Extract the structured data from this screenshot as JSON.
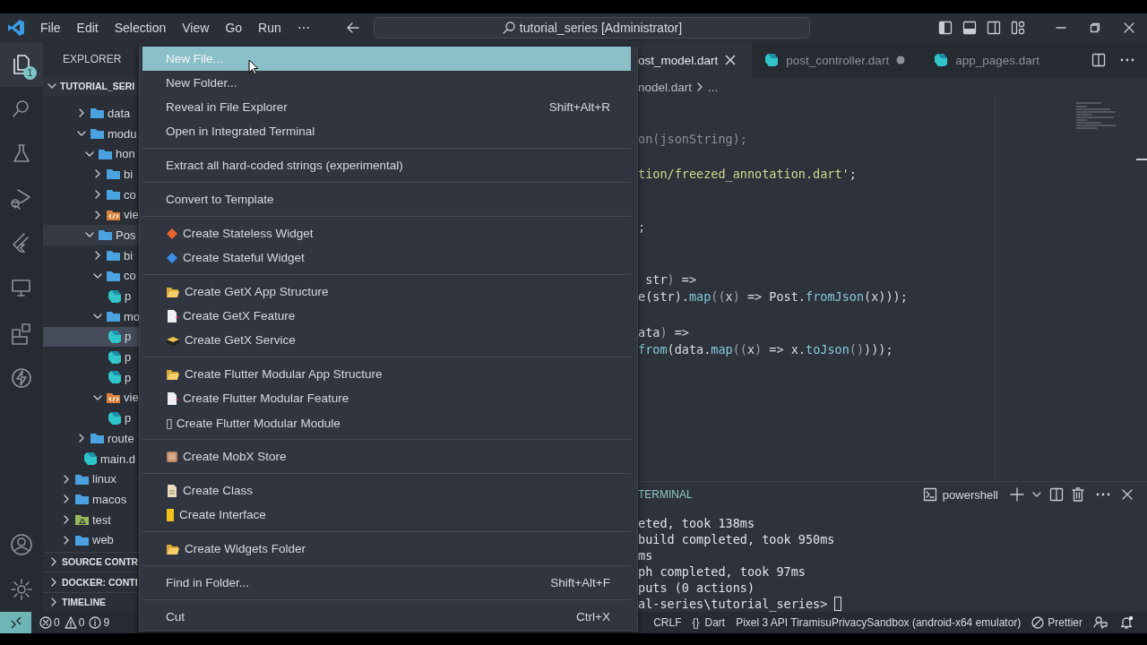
{
  "title_bar": {
    "menus": [
      "File",
      "Edit",
      "Selection",
      "View",
      "Go",
      "Run",
      "⋯"
    ],
    "command_center": "tutorial_series [Administrator]"
  },
  "activity_bar": {
    "items": [
      {
        "kind": "files",
        "badge": "1",
        "selected": true
      },
      {
        "kind": "search",
        "selected": false
      },
      {
        "kind": "flask",
        "selected": false
      },
      {
        "kind": "debug",
        "selected": false
      },
      {
        "kind": "flutter",
        "selected": false
      },
      {
        "kind": "remote",
        "selected": false
      },
      {
        "kind": "extensions",
        "selected": false
      },
      {
        "kind": "lightning",
        "selected": false
      }
    ],
    "bottom": [
      {
        "kind": "account"
      },
      {
        "kind": "settings"
      }
    ]
  },
  "sidebar": {
    "title": "EXPLORER",
    "root": {
      "label": "TUTORIAL_SERI",
      "expanded": true
    },
    "tree": [
      {
        "children": [
          {
            "label": "data",
            "kind": "folder",
            "expanded": false,
            "selected": false,
            "hover": false
          },
          {
            "label": "modu",
            "kind": "folder",
            "expanded": true,
            "selected": false,
            "hover": false,
            "children": [
              {
                "label": "hon",
                "kind": "folder",
                "expanded": true,
                "selected": false,
                "hover": false,
                "children": [
                  {
                    "label": "bi",
                    "kind": "folder",
                    "expanded": false,
                    "selected": false,
                    "hover": false
                  },
                  {
                    "label": "co",
                    "kind": "folder",
                    "expanded": false,
                    "selected": false,
                    "hover": false
                  },
                  {
                    "label": "vie",
                    "kind": "view",
                    "expanded": false,
                    "selected": false,
                    "hover": false
                  }
                ]
              },
              {
                "label": "Pos",
                "kind": "folder",
                "expanded": true,
                "selected": false,
                "hover": true,
                "children": [
                  {
                    "label": "bi",
                    "kind": "folder",
                    "expanded": false,
                    "selected": false,
                    "hover": false
                  },
                  {
                    "label": "co",
                    "kind": "folder",
                    "expanded": true,
                    "selected": false,
                    "hover": false,
                    "children": [
                      {
                        "label": "p",
                        "kind": "dart",
                        "selected": false,
                        "hover": false
                      }
                    ]
                  },
                  {
                    "label": "mo",
                    "kind": "folder",
                    "expanded": true,
                    "selected": false,
                    "hover": false,
                    "children": [
                      {
                        "label": "p",
                        "kind": "dart",
                        "selected": true,
                        "hover": false
                      },
                      {
                        "label": "p",
                        "kind": "dart",
                        "selected": false,
                        "hover": false
                      },
                      {
                        "label": "p",
                        "kind": "dart",
                        "selected": false,
                        "hover": false
                      }
                    ]
                  },
                  {
                    "label": "vie",
                    "kind": "view",
                    "expanded": true,
                    "selected": false,
                    "hover": false,
                    "children": [
                      {
                        "label": "p",
                        "kind": "dart",
                        "selected": false,
                        "hover": false
                      }
                    ]
                  }
                ]
              }
            ]
          },
          {
            "label": "route",
            "kind": "folder",
            "expanded": false,
            "selected": false,
            "hover": false
          },
          {
            "label": "main.d",
            "kind": "dart",
            "selected": false,
            "hover": false
          }
        ]
      },
      {
        "label": "linux",
        "kind": "folder",
        "expanded": false,
        "selected": false,
        "hover": false
      },
      {
        "label": "macos",
        "kind": "folder",
        "expanded": false,
        "selected": false,
        "hover": false
      },
      {
        "label": "test",
        "kind": "test",
        "expanded": false,
        "selected": false,
        "hover": false
      },
      {
        "label": "web",
        "kind": "folder",
        "expanded": false,
        "selected": false,
        "hover": false
      }
    ],
    "sections": [
      {
        "label": "SOURCE CONTR",
        "expanded": false
      },
      {
        "label": "DOCKER: CONTI",
        "expanded": false
      },
      {
        "label": "TIMELINE",
        "expanded": false
      }
    ]
  },
  "context_menu": {
    "groups": [
      [
        {
          "label": "New File...",
          "selected": true
        },
        {
          "label": "New Folder...",
          "selected": false
        },
        {
          "label": "Reveal in File Explorer",
          "shortcut": "Shift+Alt+R",
          "selected": false
        },
        {
          "label": "Open in Integrated Terminal",
          "selected": false
        }
      ],
      [
        {
          "label": "Extract all hard-coded strings (experimental)",
          "selected": false
        }
      ],
      [
        {
          "label": "Convert to Template",
          "selected": false
        }
      ],
      [
        {
          "label": "Create Stateless Widget",
          "kind": "diamond",
          "color": "#e8662e",
          "selected": false
        },
        {
          "label": "Create Stateful Widget",
          "kind": "diamond",
          "color": "#3a8ee6",
          "selected": false
        }
      ],
      [
        {
          "label": "Create GetX App Structure",
          "kind": "folder",
          "selected": false
        },
        {
          "label": "Create GetX Feature",
          "kind": "file",
          "selected": false
        },
        {
          "label": "Create GetX Service",
          "kind": "box",
          "selected": false
        }
      ],
      [
        {
          "label": "Create Flutter Modular App Structure",
          "kind": "folder",
          "selected": false
        },
        {
          "label": "Create Flutter Modular Feature",
          "kind": "file",
          "selected": false
        },
        {
          "label": "▯ Create Flutter Modular Module",
          "selected": false
        }
      ],
      [
        {
          "label": "Create MobX Store",
          "kind": "store",
          "selected": false
        }
      ],
      [
        {
          "label": "Create Class",
          "kind": "class",
          "selected": false
        },
        {
          "label": "Create Interface",
          "kind": "interface",
          "selected": false
        }
      ],
      [
        {
          "label": "Create Widgets Folder",
          "kind": "folder",
          "selected": false
        }
      ],
      [
        {
          "label": "Find in Folder...",
          "shortcut": "Shift+Alt+F",
          "selected": false
        }
      ],
      [
        {
          "label": "Cut",
          "shortcut": "Ctrl+X",
          "selected": false
        }
      ]
    ]
  },
  "editor": {
    "tabs": [
      {
        "label": "ost_model.dart",
        "selected": true,
        "modified": false
      },
      {
        "label": "post_controller.dart",
        "kind": "dart",
        "selected": false,
        "modified": true
      },
      {
        "label": "app_pages.dart",
        "kind": "dart",
        "selected": false,
        "modified": false
      }
    ],
    "breadcrumb": [
      "nodel.dart",
      "..."
    ],
    "code": [
      {
        "kind": "tight",
        "tokens": [
          {
            "text": "on(jsonString);",
            "kind": "dim"
          }
        ]
      },
      {
        "kind": "spaced",
        "tokens": [
          {
            "text": "tion/freezed_annotation.dart'",
            "kind": "str"
          },
          {
            "text": ";",
            "kind": "plain"
          }
        ]
      },
      {
        "kind": "wide",
        "tokens": [
          {
            "text": ";",
            "kind": "plain"
          }
        ]
      },
      {
        "kind": "wide",
        "tokens": [
          {
            "text": " str",
            "kind": "plain"
          },
          {
            "text": ")",
            "kind": "punct"
          },
          {
            "text": " =>",
            "kind": "plain"
          }
        ]
      },
      {
        "kind": "tight",
        "tokens": [
          {
            "text": "e(str).",
            "kind": "plain"
          },
          {
            "text": "map",
            "kind": "fn"
          },
          {
            "text": "((",
            "kind": "punct"
          },
          {
            "text": "x",
            "kind": "plain"
          },
          {
            "text": ")",
            "kind": "punct"
          },
          {
            "text": " => Post.",
            "kind": "plain"
          },
          {
            "text": "fromJson",
            "kind": "fn"
          },
          {
            "text": "(x)));",
            "kind": "plain"
          }
        ]
      },
      {
        "kind": "spaced",
        "tokens": [
          {
            "text": "ata",
            "kind": "plain"
          },
          {
            "text": ")",
            "kind": "punct"
          },
          {
            "text": " =>",
            "kind": "plain"
          }
        ]
      },
      {
        "kind": "tight",
        "tokens": [
          {
            "text": "from",
            "kind": "fn"
          },
          {
            "text": "(data.",
            "kind": "plain"
          },
          {
            "text": "map",
            "kind": "fn"
          },
          {
            "text": "((",
            "kind": "punct"
          },
          {
            "text": "x",
            "kind": "plain"
          },
          {
            "text": ")",
            "kind": "punct"
          },
          {
            "text": " => x.",
            "kind": "plain"
          },
          {
            "text": "toJson",
            "kind": "fn"
          },
          {
            "text": "()",
            "kind": "punct"
          },
          {
            "text": ")));",
            "kind": "plain"
          }
        ]
      }
    ]
  },
  "panel": {
    "tab": "TERMINAL",
    "shell": "powershell",
    "lines": [
      {
        "text": "eted, took 138ms"
      },
      {
        "text": "build completed, took 950ms"
      },
      {
        "text": "ms"
      },
      {
        "text": "ph completed, took 97ms"
      },
      {
        "text": "puts (0 actions)"
      },
      {
        "text": "al-series\\tutorial_series> ",
        "cursor": true
      }
    ]
  },
  "status_bar": {
    "problems": [
      {
        "kind": "error",
        "count": "0"
      },
      {
        "kind": "warning",
        "count": "0"
      },
      {
        "kind": "info",
        "count": "9"
      }
    ],
    "right": [
      {
        "text": "CRLF"
      },
      {
        "glyph": "{}",
        "text": "Dart"
      },
      {
        "text": "Pixel 3 API TiramisuPrivacySandbox (android-x64 emulator)"
      },
      {
        "kind": "no",
        "text": "Prettier"
      },
      {
        "kind": "feedback"
      },
      {
        "kind": "bell"
      }
    ]
  }
}
